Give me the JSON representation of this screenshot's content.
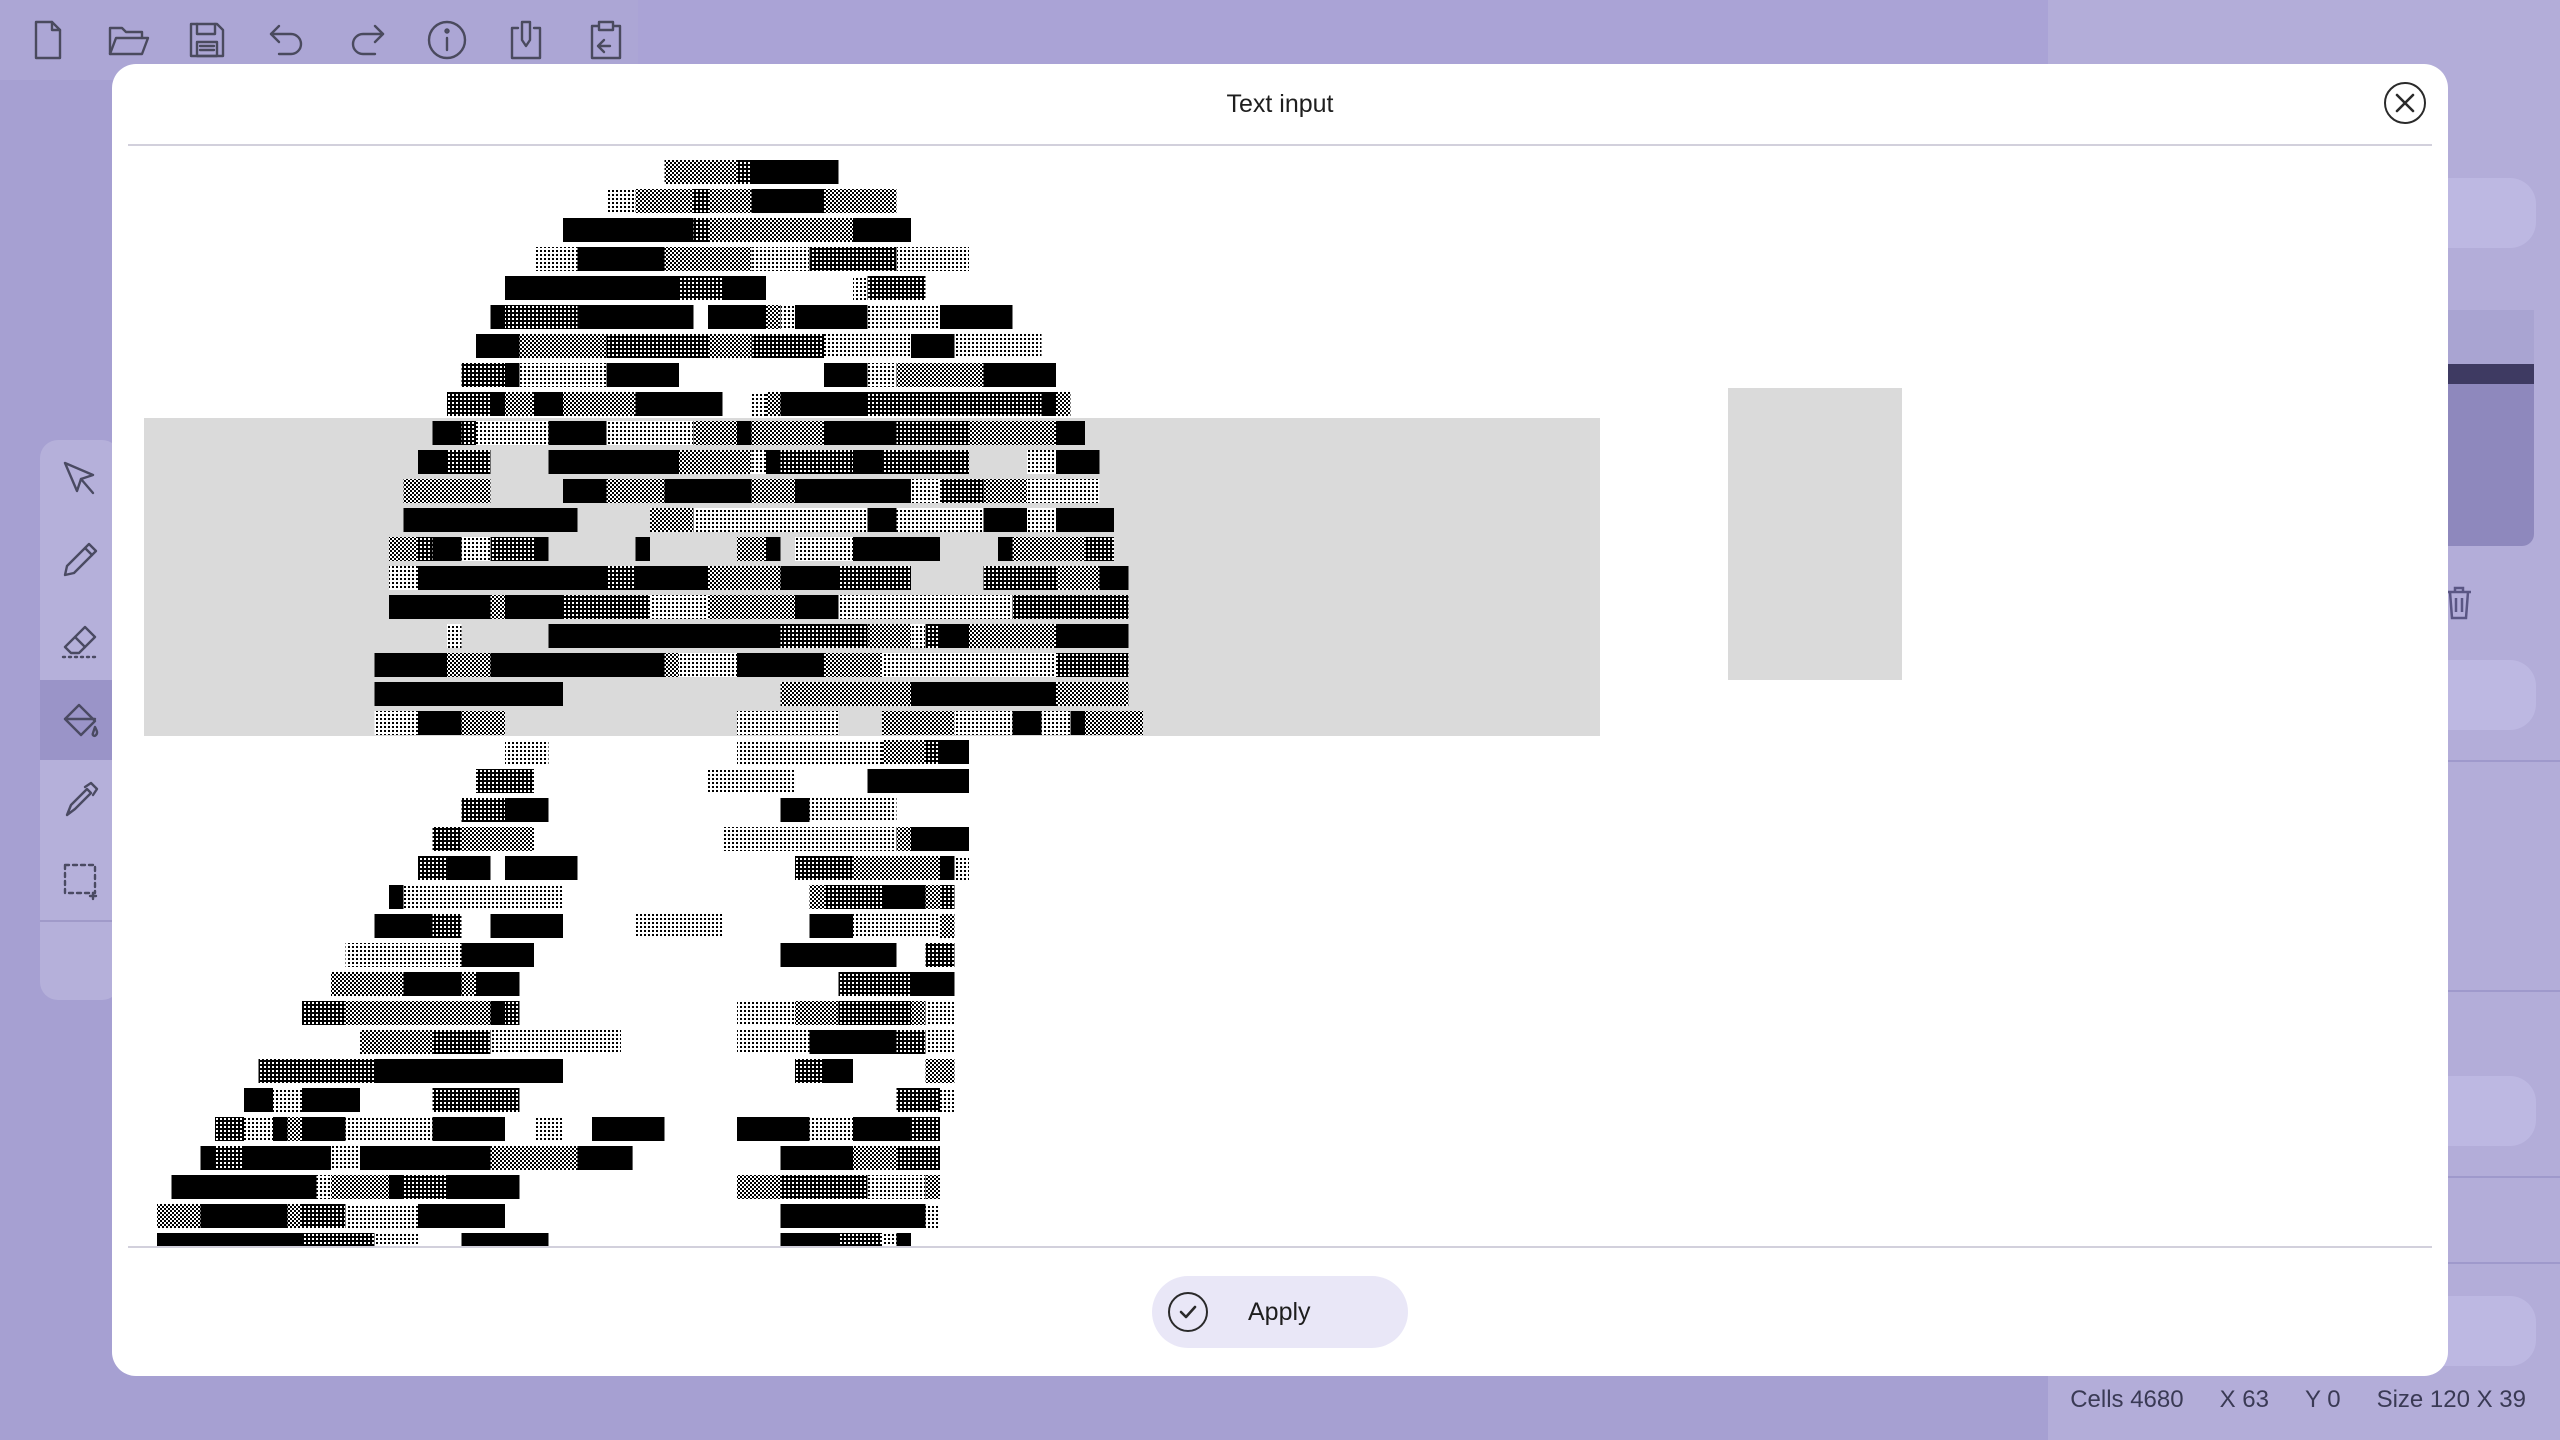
{
  "toolbar": {
    "items": [
      {
        "name": "new-file-icon"
      },
      {
        "name": "open-folder-icon"
      },
      {
        "name": "save-icon"
      },
      {
        "name": "undo-icon"
      },
      {
        "name": "redo-icon"
      },
      {
        "name": "info-icon"
      },
      {
        "name": "export-icon"
      },
      {
        "name": "clipboard-icon"
      }
    ]
  },
  "left_tools": {
    "items": [
      {
        "name": "select-arrow-icon",
        "active": false
      },
      {
        "name": "pencil-icon",
        "active": false
      },
      {
        "name": "eraser-icon",
        "active": false
      },
      {
        "name": "paint-bucket-icon",
        "active": true
      },
      {
        "name": "eyedropper-icon",
        "active": false
      },
      {
        "name": "rectangle-select-icon",
        "active": false
      }
    ]
  },
  "dialog": {
    "title": "Text input",
    "apply_label": "Apply"
  },
  "status": {
    "cells": "Cells 4680",
    "x": "X 63",
    "y": "Y 0",
    "size": "Size 120 X 39"
  },
  "colors": {
    "background": "#a6a0d2",
    "panel": "#b3add9",
    "dialog": "#ffffff",
    "selection": "#dadada",
    "apply_button": "#e9e7f7"
  }
}
